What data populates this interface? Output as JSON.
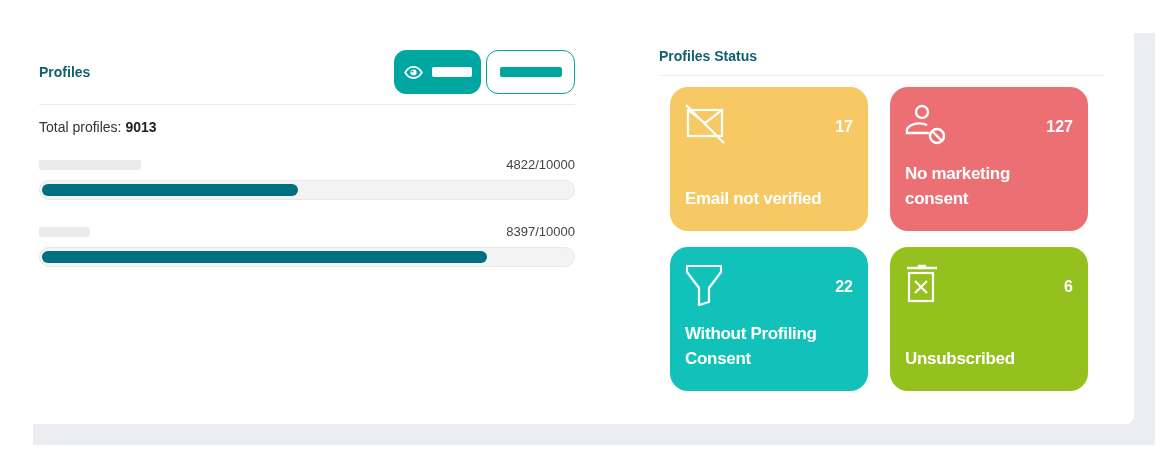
{
  "profiles": {
    "title": "Profiles",
    "buttons": [
      {
        "kind": "filled"
      },
      {
        "kind": "outline"
      }
    ],
    "total": "Total profiles: **9013**",
    "meters": [
      {
        "reading": "4822/10000",
        "level": 0.4822,
        "kind": "long"
      },
      {
        "reading": "8397/10000",
        "level": 0.8397,
        "kind": "short"
      }
    ]
  },
  "status": {
    "title": "Profiles Status",
    "cards": [
      {
        "kind": "email",
        "count": "17",
        "label": "Email not verified",
        "color": "#f7c965"
      },
      {
        "kind": "person",
        "count": "127",
        "label": "No marketing consent",
        "color": "#ec7073"
      },
      {
        "kind": "filter",
        "count": "22",
        "label": "Without Profiling Consent",
        "color": "#12c1b9"
      },
      {
        "kind": "trash",
        "count": "6",
        "label": "Unsubscribed",
        "color": "#95c11f"
      }
    ]
  }
}
